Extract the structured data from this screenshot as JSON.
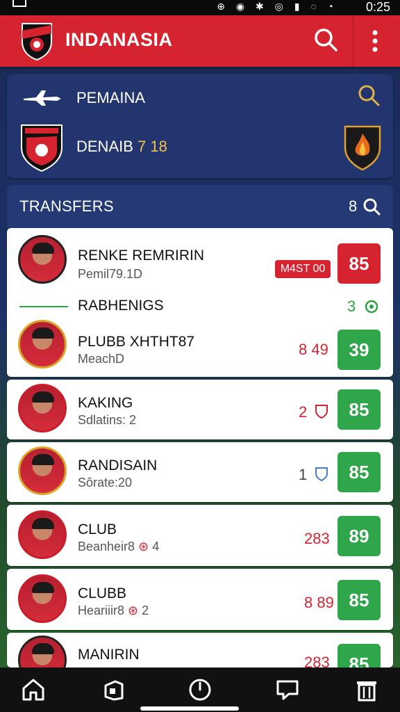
{
  "status_bar": {
    "time": "0:25",
    "icons": "⊕ ◉ ✱ ◎ ▮ ◌ ◔"
  },
  "app_bar": {
    "title": "INDANASIA"
  },
  "league_card": {
    "row1_label": "PEMAINA",
    "row2_label": "DENAIB",
    "row2_number": "7 18"
  },
  "transfers": {
    "label": "TRANSFERS",
    "count": "8"
  },
  "items": [
    {
      "name": "RENKE REMRIRIN",
      "sub": "Pemil79.1D",
      "tag": "M4ST 00",
      "score": "85",
      "score_color": "red"
    },
    {
      "name": "RABHENIGS",
      "meta": "3",
      "meta_color": "green"
    },
    {
      "name": "PLUBB XHTHT87",
      "sub": "MeachD",
      "meta": "8 49",
      "meta_color": "red",
      "score": "39",
      "score_color": "green"
    },
    {
      "name": "KAKING",
      "sub": "Sdlatins: 2",
      "meta": "2",
      "meta_color": "red",
      "score": "85",
      "score_color": "green"
    },
    {
      "name": "RANDISAIN",
      "sub": "Sôrate:20",
      "meta": "1",
      "meta_color": "blue",
      "score": "85",
      "score_color": "green"
    },
    {
      "name": "CLUB",
      "sub": "Beanheir8",
      "sub_num": "4",
      "meta": "283",
      "meta_color": "red",
      "score": "89",
      "score_color": "green"
    },
    {
      "name": "CLUBB",
      "sub": "Heariiir8",
      "sub_num": "2",
      "meta": "8 89",
      "meta_color": "red",
      "score": "85",
      "score_color": "green"
    },
    {
      "name": "MANIRIN",
      "meta": "283",
      "meta_color": "red",
      "score": "85",
      "score_color": "green"
    }
  ],
  "colors": {
    "primary": "#d52330",
    "navy": "#22356e",
    "green": "#2fa64a"
  },
  "nav": [
    "home-icon",
    "tag-icon",
    "clock-icon",
    "chat-icon",
    "trash-icon"
  ]
}
